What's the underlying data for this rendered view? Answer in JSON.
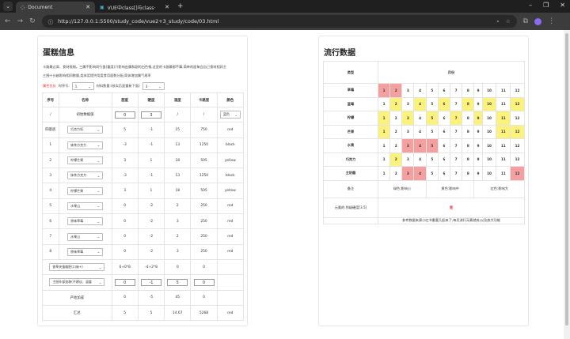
{
  "browser": {
    "tabs": [
      {
        "label": "Document",
        "active": true
      },
      {
        "label": "VUE中class[]与class{} - 哔哩",
        "active": false
      }
    ],
    "url": "http://127.0.0.1:5500/study_code/vue2+3_study/code/03.html"
  },
  "left": {
    "title": "蛋糕信息",
    "desc1": "卡路最过高、食材限制。三属不影响同行蛋(重度)只影响出属和副的白色格,这里的卡路最都不算,简单的面每会自己食材相同主",
    "desc2": "三围十分越影响相同数量,类体奖提供用度食用面数分配,简体增加属气规率",
    "ctl_label1": "属性优化",
    "ctl_label1b": "时序号:",
    "ctl_sel1": "1",
    "ctl_label2": "材料数量:(核实后面重新下面)",
    "ctl_sel2": "3",
    "headers": [
      "序号",
      "名称",
      "甜度",
      "硬度",
      "温度",
      "卡路里",
      "颜色"
    ],
    "top_row": {
      "no": "/",
      "name": "初始数据值",
      "sweet": "0",
      "hard": "3",
      "temp": "/",
      "cal": "/",
      "color": "蓝色"
    },
    "rows": [
      {
        "no": "四基底",
        "name": "巧克力坯",
        "a": "5",
        "b": "-1",
        "c": "15",
        "d": "750",
        "e": "red"
      },
      {
        "no": "1",
        "name": "抹茶方克力",
        "a": "-3",
        "b": "-1",
        "c": "13",
        "d": "1250",
        "e": "black"
      },
      {
        "no": "2",
        "name": "柠檬芒果",
        "a": "3",
        "b": "1",
        "c": "18",
        "d": "505",
        "e": "yellow"
      },
      {
        "no": "3",
        "name": "抹茶方克力",
        "a": "-3",
        "b": "-1",
        "c": "13",
        "d": "1250",
        "e": "black"
      },
      {
        "no": "4",
        "name": "柠檬芒果",
        "a": "3",
        "b": "1",
        "c": "18",
        "d": "505",
        "e": "yellow"
      },
      {
        "no": "5",
        "name": "水果山",
        "a": "0",
        "b": "-2",
        "c": "2",
        "d": "250",
        "e": "red"
      },
      {
        "no": "6",
        "name": "原味草莓",
        "a": "0",
        "b": "-2",
        "c": "3",
        "d": "250",
        "e": "red"
      },
      {
        "no": "7",
        "name": "水果山",
        "a": "0",
        "b": "-2",
        "c": "2",
        "d": "250",
        "e": "red"
      },
      {
        "no": "8",
        "name": "原味草莓",
        "a": "0",
        "b": "-2",
        "c": "3",
        "d": "250",
        "e": "red"
      }
    ],
    "extra1": {
      "name": "香草夹蛋糕胚(口味+)",
      "a": "0+0*8",
      "b": "-4+2*8",
      "c": "0",
      "d": "0"
    },
    "extra2": {
      "name": "主厨外部加装(不建议、温度",
      "a": "0",
      "b": "-1",
      "c": "5",
      "d": "0"
    },
    "origin": {
      "label": "产地加成",
      "a": "0",
      "b": "-5",
      "c": "45",
      "d": "0"
    },
    "total": {
      "label": "汇总",
      "a": "5",
      "b": "5",
      "c": "14.67",
      "d": "5268",
      "e": "red"
    }
  },
  "right": {
    "title": "流行数据",
    "col_head": "类型",
    "month_head": "月份",
    "months": [
      "1",
      "2",
      "3",
      "4",
      "5",
      "6",
      "7",
      "8",
      "9",
      "10",
      "11",
      "12"
    ],
    "rows": [
      {
        "label": "草莓",
        "red": [
          1,
          2
        ],
        "yel": []
      },
      {
        "label": "蓝莓",
        "red": [],
        "yel": [
          2,
          4,
          6,
          8,
          10,
          12
        ]
      },
      {
        "label": "柠檬",
        "red": [],
        "yel": [
          1,
          3,
          5,
          7,
          9,
          11
        ]
      },
      {
        "label": "芒果",
        "red": [],
        "yel": [
          1,
          11,
          12
        ]
      },
      {
        "label": "水果",
        "red": [
          3,
          4,
          5
        ],
        "yel": []
      },
      {
        "label": "巧克力",
        "red": [],
        "yel": [
          2
        ]
      },
      {
        "label": "主奶酪",
        "red": [
          3,
          4,
          12
        ],
        "yel": []
      }
    ],
    "note_label": "备注",
    "notes": [
      "绿色:影响小",
      "黄色:影响中",
      "红色:影响大"
    ],
    "flag_label": "元素的:到级硬度[3.5]",
    "flag_value": "是",
    "footer": "参考数据来源小红书重要几起来了,每月流行元素就成,以及放大功能"
  },
  "colors": {
    "red": "#f5a0a0",
    "yellow": "#fbf27e"
  }
}
